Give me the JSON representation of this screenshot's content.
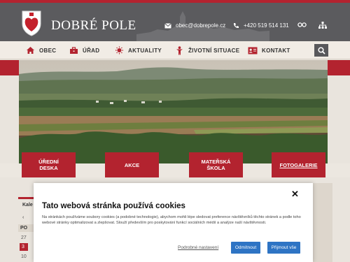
{
  "header": {
    "title": "DOBRÉ POLE",
    "email": "obec@dobrepole.cz",
    "phone": "+420 519 514 131"
  },
  "nav": {
    "items": [
      {
        "label": "OBEC",
        "icon": "home-icon"
      },
      {
        "label": "ÚŘAD",
        "icon": "briefcase-icon"
      },
      {
        "label": "AKTUALITY",
        "icon": "megaphone-icon"
      },
      {
        "label": "ŽIVOTNÍ SITUACE",
        "icon": "person-icon"
      },
      {
        "label": "KONTAKT",
        "icon": "address-card-icon"
      }
    ]
  },
  "tiles": {
    "t1": {
      "line1": "ÚŘEDNÍ",
      "line2": "DESKA"
    },
    "t2": {
      "line1": "AKCE"
    },
    "t3": {
      "line1": "MATEŘSKÁ",
      "line2": "ŠKOLA"
    },
    "t4": {
      "line1": "FOTOGALERIE"
    }
  },
  "calendar": {
    "title": "Kale",
    "nav": "‹",
    "weekday": "PO",
    "days": [
      "27",
      "3",
      "10"
    ]
  },
  "cookie": {
    "title": "Tato webová stránka používá cookies",
    "text": "Na stránkách používáme soubory cookies (a podobné technologie), abychom mohli lépe sledovat preference návštěvníků těchto stránek a podle toho webové stránky optimalizovat a zlepšovat. Slouží především pro poskytování funkcí sociálních médií a analýze naší návštěvnosti.",
    "settings_label": "Podrobné nastavení",
    "reject_label": "Odmítnout",
    "accept_label": "Přijmout vše",
    "close_symbol": "✕"
  },
  "colors": {
    "accent": "#b3232f",
    "header": "#5b5b5e",
    "button": "#2e74c4"
  }
}
